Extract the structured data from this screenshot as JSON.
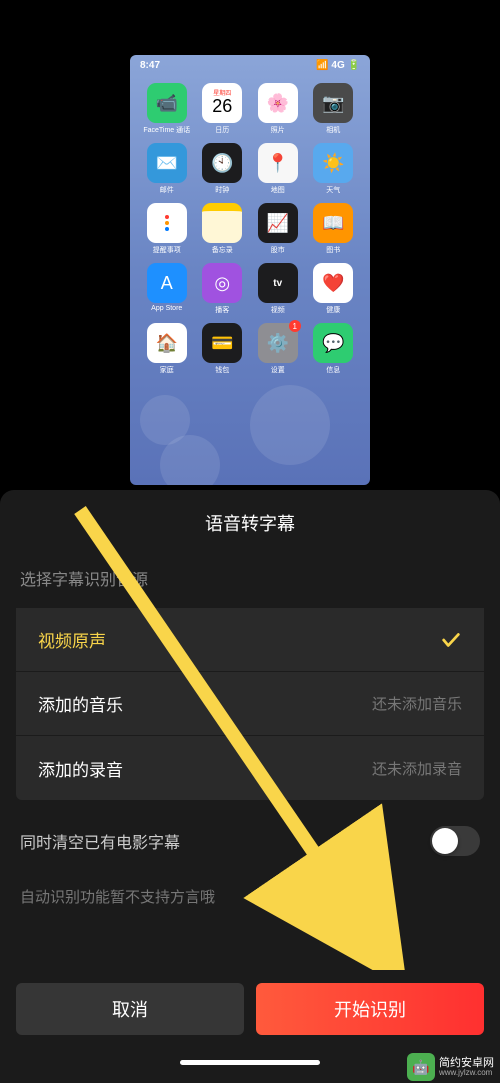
{
  "preview": {
    "statusbar": {
      "time": "8:47",
      "signal": "4G"
    },
    "calendar": {
      "weekday": "星期四",
      "day": "26"
    },
    "apps": [
      {
        "name": "facetime",
        "label": "FaceTime 通话",
        "bg": "#2ecc71",
        "glyph": "📹"
      },
      {
        "name": "calendar",
        "label": "日历",
        "bg": "#ffffff"
      },
      {
        "name": "photos",
        "label": "照片",
        "bg": "#ffffff",
        "glyph": "🌸"
      },
      {
        "name": "camera",
        "label": "相机",
        "bg": "#4a4a4a",
        "glyph": "📷"
      },
      {
        "name": "mail",
        "label": "邮件",
        "bg": "#3498db",
        "glyph": "✉️"
      },
      {
        "name": "clock",
        "label": "时钟",
        "bg": "#1c1c1e",
        "glyph": "🕙"
      },
      {
        "name": "maps",
        "label": "地图",
        "bg": "#f7f7f7",
        "glyph": "📍"
      },
      {
        "name": "weather",
        "label": "天气",
        "bg": "#58a9ee",
        "glyph": "☀️"
      },
      {
        "name": "reminders",
        "label": "提醒事项",
        "bg": "#ffffff",
        "glyph": "•"
      },
      {
        "name": "notes",
        "label": "备忘录",
        "bg": "#fff7d6",
        "glyph": ""
      },
      {
        "name": "stocks",
        "label": "股市",
        "bg": "#1c1c1e",
        "glyph": "📈"
      },
      {
        "name": "books",
        "label": "图书",
        "bg": "#ff9500",
        "glyph": "📖"
      },
      {
        "name": "appstore",
        "label": "App Store",
        "bg": "#1e90ff",
        "glyph": "A"
      },
      {
        "name": "podcasts",
        "label": "播客",
        "bg": "#a052e0",
        "glyph": "◎"
      },
      {
        "name": "tv",
        "label": "视频",
        "bg": "#1c1c1e",
        "glyph": "tv"
      },
      {
        "name": "health",
        "label": "健康",
        "bg": "#ffffff",
        "glyph": "❤️"
      },
      {
        "name": "home",
        "label": "家庭",
        "bg": "#ffffff",
        "glyph": "🏠"
      },
      {
        "name": "wallet",
        "label": "钱包",
        "bg": "#1c1c1e",
        "glyph": "💳"
      },
      {
        "name": "settings",
        "label": "设置",
        "bg": "#8e8e93",
        "glyph": "⚙️",
        "badge": "1"
      },
      {
        "name": "messages",
        "label": "信息",
        "bg": "#2ecc71",
        "glyph": "💬"
      }
    ]
  },
  "sheet": {
    "title": "语音转字幕",
    "section_label": "选择字幕识别音源",
    "options": [
      {
        "key": "original",
        "label": "视频原声",
        "selected": true
      },
      {
        "key": "music",
        "label": "添加的音乐",
        "hint": "还未添加音乐",
        "selected": false
      },
      {
        "key": "recording",
        "label": "添加的录音",
        "hint": "还未添加录音",
        "selected": false
      }
    ],
    "toggle": {
      "label": "同时清空已有电影字幕",
      "on": false
    },
    "hint": "自动识别功能暂不支持方言哦",
    "buttons": {
      "cancel": "取消",
      "start": "开始识别"
    }
  },
  "colors": {
    "accent_yellow": "#f9d54a",
    "start_button": "#ff3030"
  },
  "watermark": {
    "cn": "简约安卓网",
    "url": "www.jylzw.com"
  }
}
